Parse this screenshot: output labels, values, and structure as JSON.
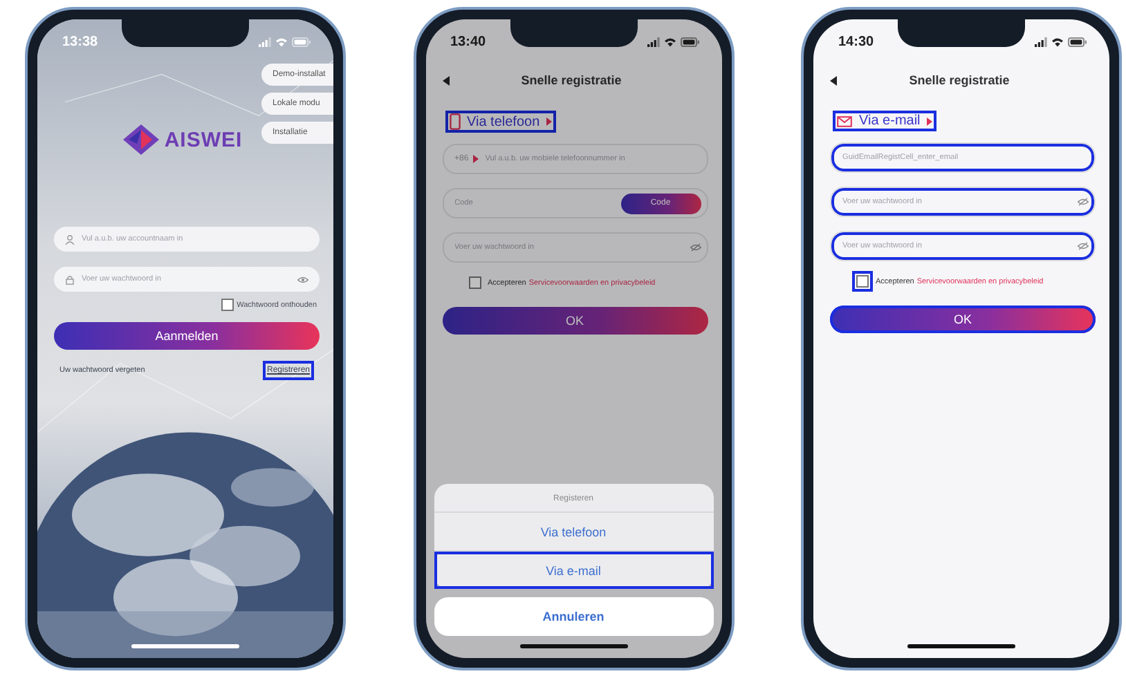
{
  "phones": [
    {
      "kind": "login",
      "time": "13:38",
      "side_buttons": [
        {
          "label": "Demo-installat"
        },
        {
          "label": "Lokale modu"
        },
        {
          "label": "Installatie"
        }
      ],
      "logo": "AISWEI",
      "fields": [
        {
          "kind": "account",
          "placeholder": "Vul a.u.b. uw accountnaam in"
        },
        {
          "kind": "password",
          "placeholder": "Voer uw wachtwoord in"
        }
      ],
      "remember": {
        "label": "Wachtwoord onthouden",
        "checked": false
      },
      "login_button": "Aanmelden",
      "forgot": "Uw wachtwoord vergeten",
      "register": {
        "label": "Registreren",
        "highlighted": true
      }
    },
    {
      "kind": "register",
      "time": "13:40",
      "title": "Snelle registratie",
      "method": {
        "kind": "phone",
        "label": "Via telefoon",
        "highlighted": true
      },
      "fields": [
        {
          "kind": "phone",
          "prefix": "+86",
          "placeholder": "Vul a.u.b. uw mobiele telefoonnummer in",
          "highlighted": false
        },
        {
          "kind": "code",
          "placeholder": "Code",
          "button": "Code",
          "highlighted": false
        },
        {
          "kind": "password",
          "placeholder": "Voer uw wachtwoord in",
          "highlighted": false
        }
      ],
      "agreement": {
        "label": "Accepteren",
        "link": "Servicevoorwaarden en privacybeleid",
        "checked": false,
        "highlighted": false
      },
      "ok": {
        "label": "OK",
        "highlighted": false
      },
      "sheet": {
        "title": "Registeren",
        "options": [
          {
            "label": "Via telefoon",
            "highlighted": false
          },
          {
            "label": "Via e-mail",
            "highlighted": true
          }
        ],
        "cancel": "Annuleren"
      }
    },
    {
      "kind": "register",
      "time": "14:30",
      "title": "Snelle registratie",
      "method": {
        "kind": "email",
        "label": "Via e-mail",
        "highlighted": true
      },
      "fields": [
        {
          "kind": "email",
          "placeholder": "GuidEmailRegistCell_enter_email",
          "highlighted": true
        },
        {
          "kind": "password",
          "placeholder": "Voer uw wachtwoord in",
          "highlighted": true
        },
        {
          "kind": "password",
          "placeholder": "Voer uw wachtwoord in",
          "highlighted": true
        }
      ],
      "agreement": {
        "label": "Accepteren",
        "link": "Servicevoorwaarden en privacybeleid",
        "checked": false,
        "highlighted": true
      },
      "ok": {
        "label": "OK",
        "highlighted": true
      }
    }
  ]
}
